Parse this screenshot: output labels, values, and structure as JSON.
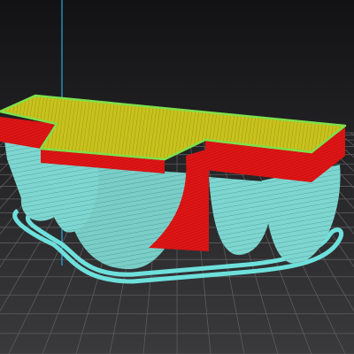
{
  "viewport": {
    "view": "3d-layer-preview",
    "colors": {
      "background_top": "#121214",
      "background_bottom": "#3a3a3c",
      "bed_grid": "#5c5c5e",
      "top_surface": "#c8c21e",
      "top_edge": "#7fe04a",
      "solid_infill": "#e01515",
      "support": "#7fd6d0",
      "skirt": "#6ee0dc",
      "axis_line": "#2aa8e0"
    },
    "icons": {
      "axis": "z-axis-line",
      "model": "sliced-model",
      "support": "support-structure",
      "skirt": "skirt-outline"
    }
  }
}
